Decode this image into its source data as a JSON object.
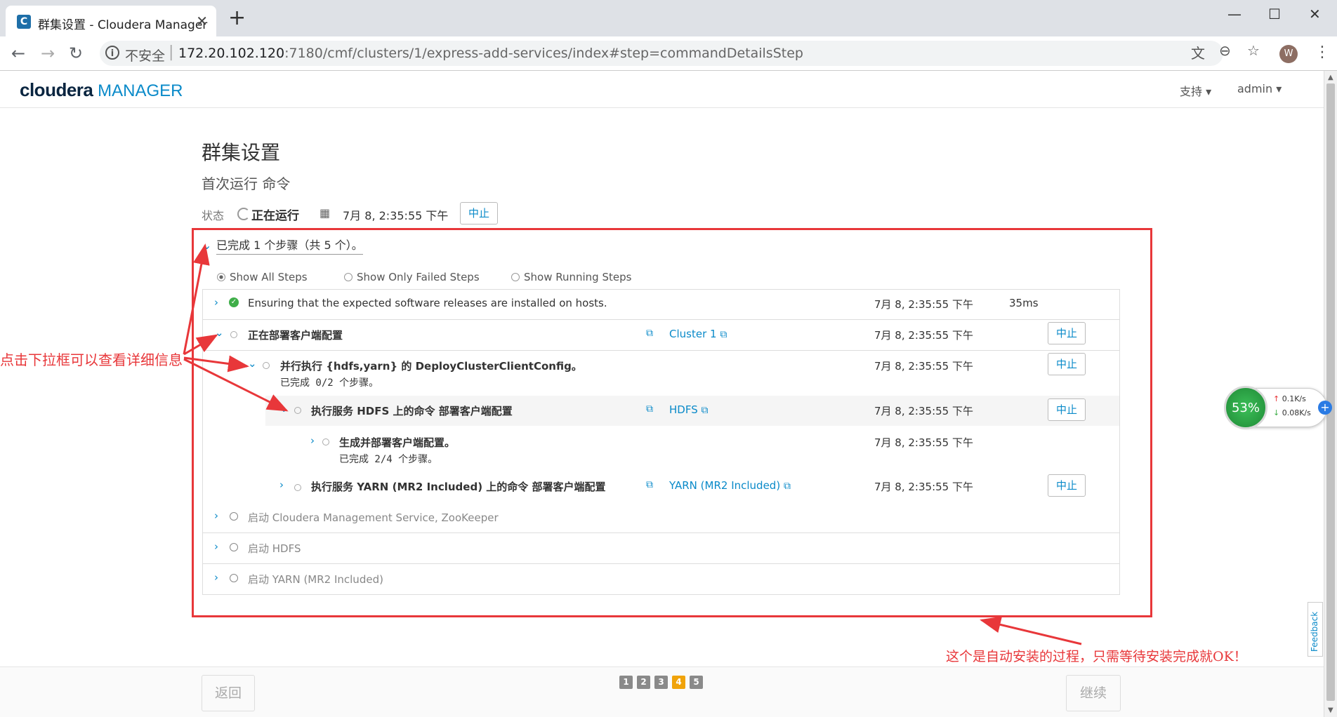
{
  "browser": {
    "tab_title": "群集设置 - Cloudera Manager",
    "tab_close": "✕",
    "new_tab": "+",
    "security_label": "不安全",
    "url_host": "172.20.102.120",
    "url_rest": ":7180/cmf/clusters/1/express-add-services/index#step=commandDetailsStep",
    "avatar_letter": "W"
  },
  "app": {
    "logo_brand": "cloudera",
    "logo_product": "MANAGER",
    "support_menu": "支持 ▾",
    "user_menu": "admin ▾"
  },
  "page": {
    "title": "群集设置",
    "subtitle": "首次运行 命令",
    "status_label": "状态",
    "status_text": "正在运行",
    "status_time": "7月 8, 2:35:55 下午",
    "abort_label": "中止",
    "summary": "已完成 1 个步骤（共 5 个）。"
  },
  "filters": {
    "all": "Show All Steps",
    "failed": "Show Only Failed Steps",
    "running": "Show Running Steps",
    "selected": "all"
  },
  "steps": [
    {
      "text": "Ensuring that the expected software releases are installed on hosts.",
      "time": "7月 8, 2:35:55 下午",
      "duration": "35ms"
    },
    {
      "text": "正在部署客户端配置",
      "link": "Cluster 1",
      "time": "7月 8, 2:35:55 下午",
      "abort": "中止"
    },
    {
      "text": "并行执行 {hdfs,yarn} 的 DeployClusterClientConfig。",
      "sub": "已完成 0/2 个步骤。",
      "time": "7月 8, 2:35:55 下午",
      "abort": "中止"
    },
    {
      "text": "执行服务 HDFS 上的命令 部署客户端配置",
      "link": "HDFS",
      "time": "7月 8, 2:35:55 下午",
      "abort": "中止"
    },
    {
      "text": "生成并部署客户端配置。",
      "sub": "已完成 2/4 个步骤。",
      "time": "7月 8, 2:35:55 下午"
    },
    {
      "text": "执行服务 YARN (MR2 Included) 上的命令 部署客户端配置",
      "link": "YARN (MR2 Included)",
      "time": "7月 8, 2:35:55 下午",
      "abort": "中止"
    },
    {
      "text": "启动 Cloudera Management Service, ZooKeeper"
    },
    {
      "text": "启动 HDFS"
    },
    {
      "text": "启动 YARN (MR2 Included)"
    }
  ],
  "annotations": {
    "left": "点击下拉框可以查看详细信息",
    "bottom": "这个是自动安装的过程，只需等待安装完成就OK！",
    "color": "#e8373a"
  },
  "footer": {
    "back": "返回",
    "next": "继续",
    "pages": [
      "1",
      "2",
      "3",
      "4",
      "5"
    ],
    "current_page": 4
  },
  "net_widget": {
    "percent": "53%",
    "up": "0.1K/s",
    "down": "0.08K/s"
  },
  "feedback": "Feedback",
  "colors": {
    "accent": "#0a8ac9",
    "success": "#3fae49",
    "current_page": "#f0a30a"
  }
}
